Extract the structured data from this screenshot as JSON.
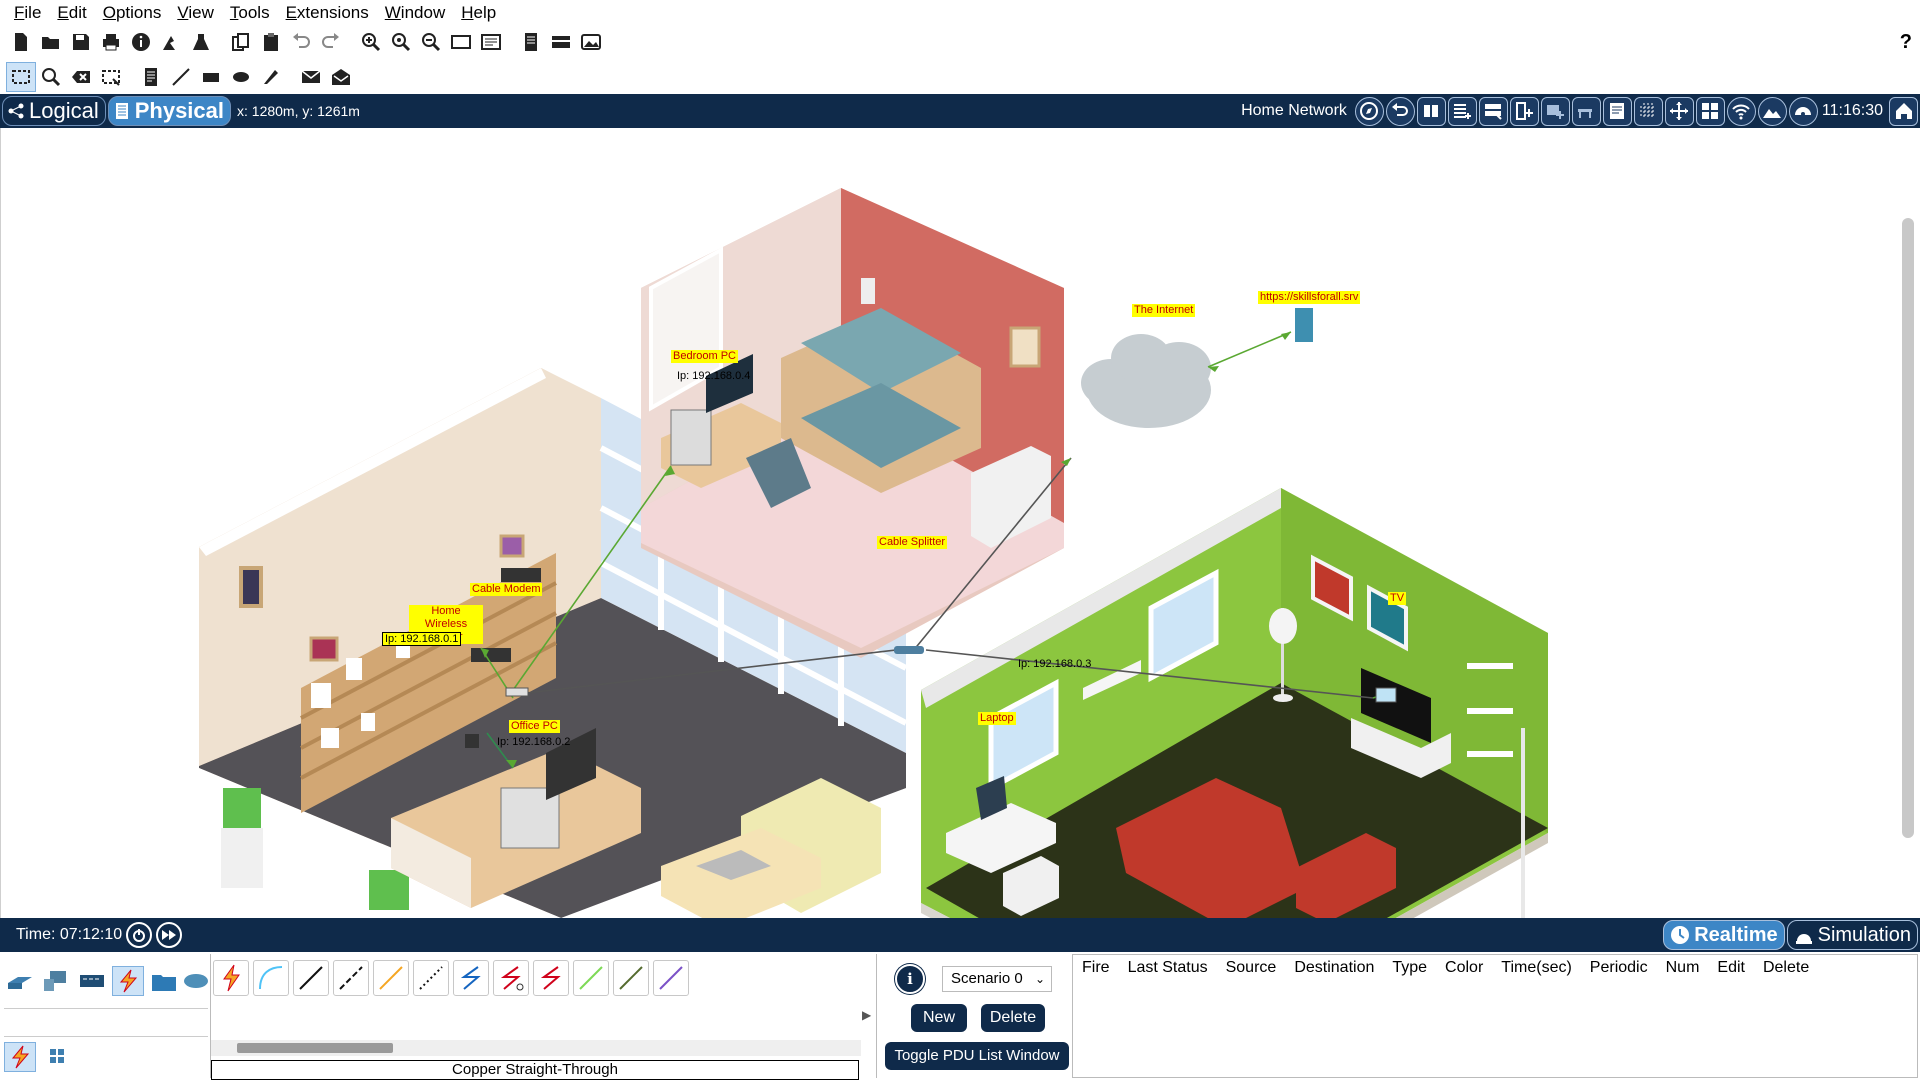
{
  "menu": [
    "File",
    "Edit",
    "Options",
    "View",
    "Tools",
    "Extensions",
    "Window",
    "Help"
  ],
  "toolbar": {
    "main_icons": [
      "new-file-icon",
      "open-icon",
      "save-icon",
      "print-icon",
      "info-icon",
      "activity-wizard-icon",
      "flask-icon",
      "copy-icon",
      "paste-icon",
      "undo-icon",
      "redo-icon",
      "zoom-in-icon",
      "zoom-reset-icon",
      "zoom-out-icon",
      "drawing-palette-icon",
      "custom-device-icon",
      "cluster-icon",
      "viewport-icon",
      "device-template-icon"
    ],
    "edit_icons": [
      "select-icon",
      "inspect-icon",
      "delete-icon",
      "resize-icon",
      "note-icon",
      "line-icon",
      "rectangle-icon",
      "ellipse-icon",
      "freeform-icon",
      "simple-pdu-icon",
      "complex-pdu-icon"
    ],
    "help": "?"
  },
  "workspace": {
    "logical_tab": "Logical",
    "physical_tab": "Physical",
    "coords": "x: 1280m, y: 1261m",
    "location": "Home Network",
    "clock": "11:16:30",
    "nav_icons": [
      "navigation-icon",
      "back-icon",
      "move-object-icon",
      "new-cluster-icon",
      "new-building-icon",
      "new-closet-icon",
      "new-rack-icon",
      "new-table-icon",
      "set-background-icon",
      "grid-icon",
      "move-icon",
      "working-closet-icon",
      "wireless-icon",
      "background-image-icon",
      "environment-icon",
      "home-icon"
    ]
  },
  "devices": [
    {
      "label": "Bedroom PC",
      "ip": "Ip: 192.168.0.4"
    },
    {
      "label": "The Internet",
      "ip": ""
    },
    {
      "label": "https://skillsforall.srv",
      "ip": ""
    },
    {
      "label": "Cable Splitter",
      "ip": ""
    },
    {
      "label": "Cable Modem",
      "ip": ""
    },
    {
      "label": "Home Wireless Router",
      "ip": "Ip: 192.168.0.1"
    },
    {
      "label": "Office PC",
      "ip": "Ip: 192.168.0.2"
    },
    {
      "label": "Laptop",
      "ip": "Ip: 192.168.0.3"
    },
    {
      "label": "TV",
      "ip": ""
    }
  ],
  "bottom": {
    "time": "Time: 07:12:10",
    "realtime": "Realtime",
    "simulation": "Simulation",
    "connection_name": "Copper Straight-Through",
    "scenario": "Scenario 0",
    "new": "New",
    "delete": "Delete",
    "toggle_pdu": "Toggle PDU List Window",
    "pdu_columns": [
      "Fire",
      "Last Status",
      "Source",
      "Destination",
      "Type",
      "Color",
      "Time(sec)",
      "Periodic",
      "Num",
      "Edit",
      "Delete"
    ],
    "category_icons": [
      "network-devices-icon",
      "end-devices-icon",
      "components-icon",
      "connections-icon",
      "miscellaneous-icon",
      "multiuser-icon"
    ],
    "connection_icons": [
      "automatic-connection-icon",
      "console-cable-icon",
      "copper-straight-through-icon",
      "copper-cross-over-icon",
      "fiber-icon",
      "phone-cable-icon",
      "coaxial-icon",
      "serial-dce-icon",
      "serial-dte-icon",
      "octal-cable-icon",
      "iot-custom-cable-icon",
      "usb-cable-icon"
    ]
  },
  "colors": {
    "dark_navy": "#0f2a4a",
    "accent_blue": "#3d86c6",
    "label_yellow": "#ffff00",
    "label_red": "#c00000",
    "wall_green": "#8cc63f",
    "floor_dark": "#545257"
  }
}
